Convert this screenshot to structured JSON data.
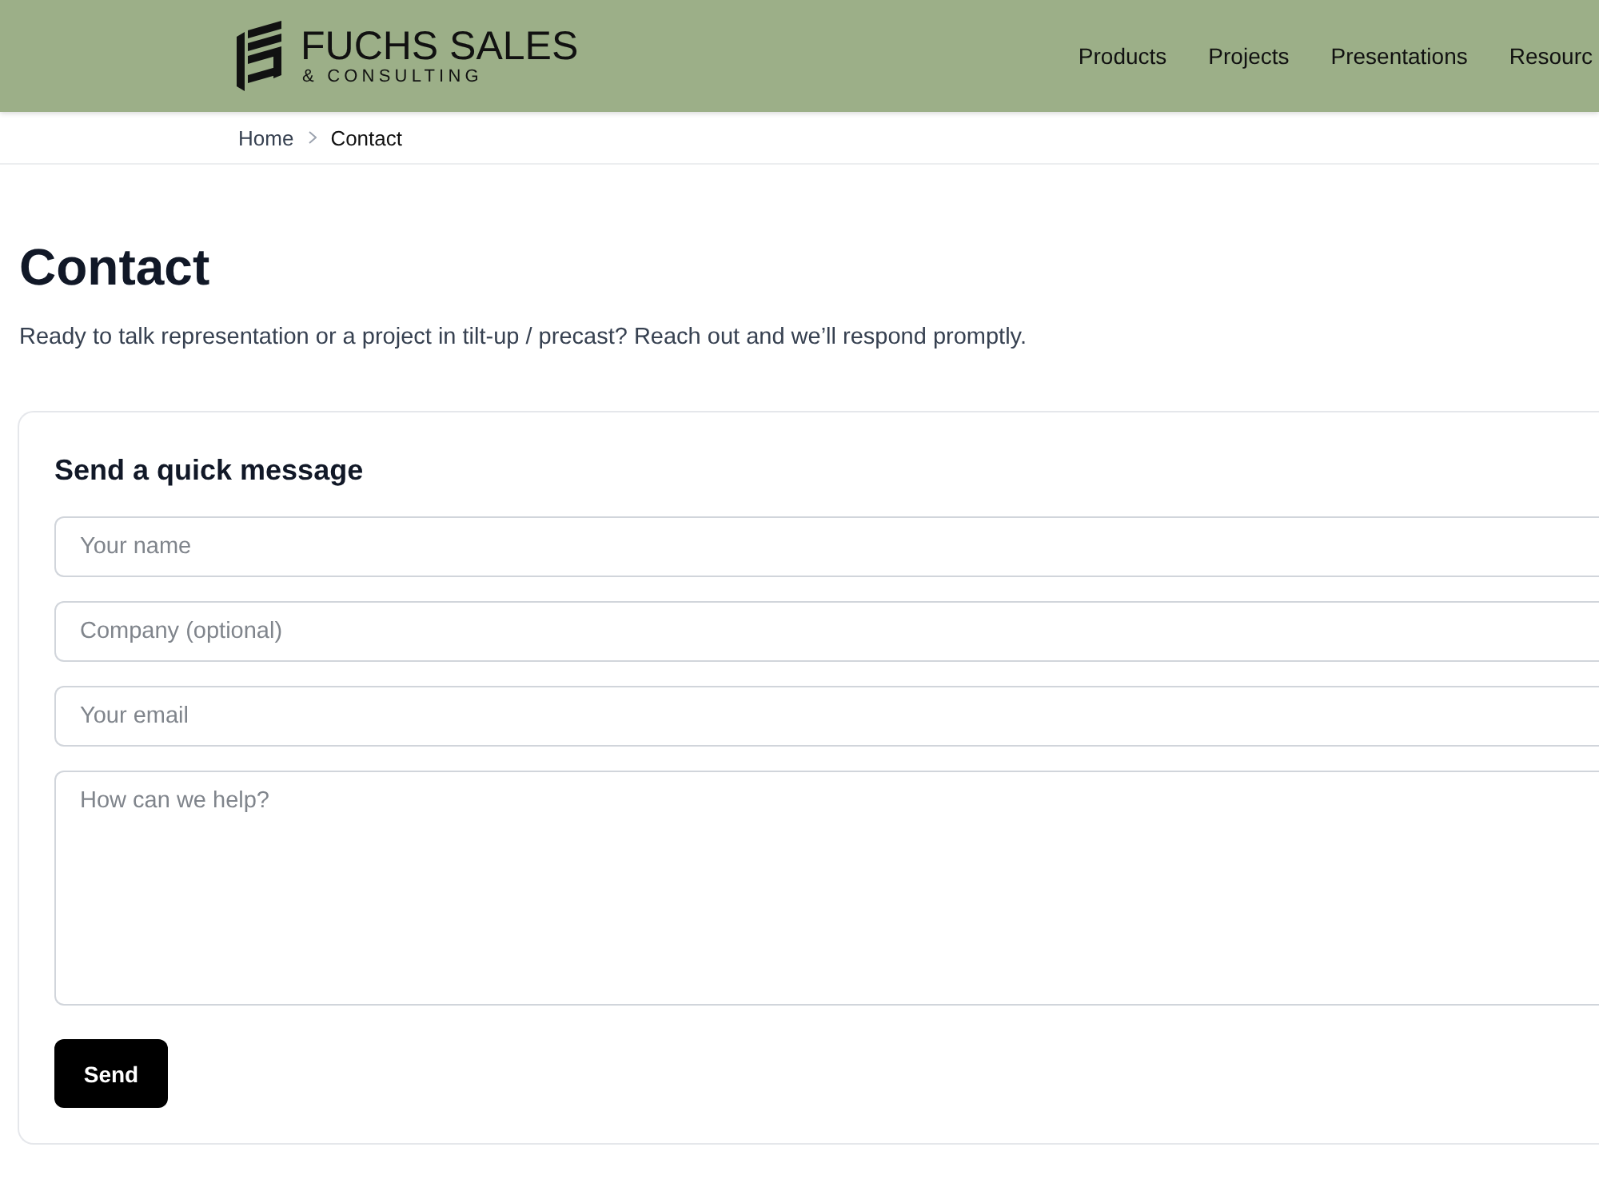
{
  "header": {
    "logo": {
      "title": "FUCHS SALES",
      "subtitle": "& CONSULTING"
    },
    "nav": [
      "Products",
      "Projects",
      "Presentations",
      "Resourc"
    ]
  },
  "breadcrumb": [
    {
      "label": "Home",
      "current": false
    },
    {
      "label": "Contact",
      "current": true
    }
  ],
  "page": {
    "title": "Contact",
    "intro": "Ready to talk representation or a project in tilt-up / precast? Reach out and we’ll respond promptly."
  },
  "form": {
    "title": "Send a quick message",
    "fields": [
      {
        "kind": "input",
        "placeholder": "Your name"
      },
      {
        "kind": "input",
        "placeholder": "Company (optional)"
      },
      {
        "kind": "input",
        "placeholder": "Your email"
      },
      {
        "kind": "textarea",
        "placeholder": "How can we help?"
      }
    ],
    "submit": "Send"
  }
}
